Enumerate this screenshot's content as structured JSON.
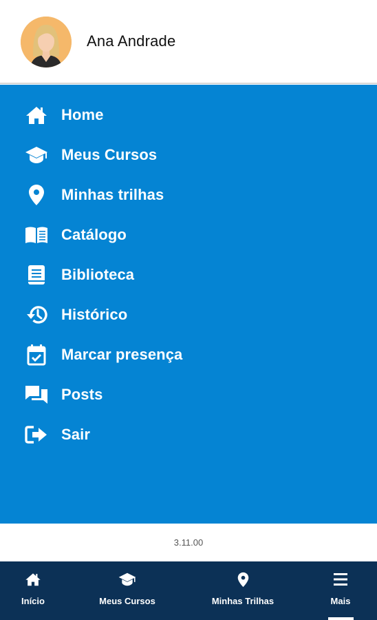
{
  "user": {
    "name": "Ana Andrade",
    "avatar_icon": "user-avatar"
  },
  "menu": {
    "background": "#0584d3",
    "items": [
      {
        "label": "Home",
        "icon": "home-icon"
      },
      {
        "label": "Meus Cursos",
        "icon": "graduation-cap-icon"
      },
      {
        "label": "Minhas trilhas",
        "icon": "map-pin-icon"
      },
      {
        "label": "Catálogo",
        "icon": "open-book-icon"
      },
      {
        "label": "Biblioteca",
        "icon": "book-icon"
      },
      {
        "label": "Histórico",
        "icon": "history-icon"
      },
      {
        "label": "Marcar presença",
        "icon": "calendar-check-icon"
      },
      {
        "label": "Posts",
        "icon": "chat-icon"
      },
      {
        "label": "Sair",
        "icon": "logout-icon"
      }
    ]
  },
  "version": "3.11.00",
  "bottom_nav": {
    "background": "#0c3156",
    "active": "Mais",
    "items": [
      {
        "label": "Início",
        "icon": "home-icon"
      },
      {
        "label": "Meus Cursos",
        "icon": "graduation-cap-icon"
      },
      {
        "label": "Minhas Trilhas",
        "icon": "map-pin-icon"
      },
      {
        "label": "Mais",
        "icon": "menu-icon"
      }
    ]
  }
}
